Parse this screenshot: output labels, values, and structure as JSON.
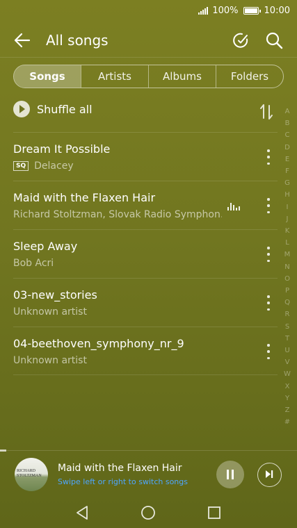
{
  "status": {
    "battery": "100%",
    "time": "10:00"
  },
  "header": {
    "title": "All songs"
  },
  "tabs": [
    {
      "label": "Songs",
      "active": true
    },
    {
      "label": "Artists",
      "active": false
    },
    {
      "label": "Albums",
      "active": false
    },
    {
      "label": "Folders",
      "active": false
    }
  ],
  "shuffle": {
    "label": "Shuffle all"
  },
  "songs": [
    {
      "title": "Dream It Possible",
      "badge": "SQ",
      "artist": "Delacey",
      "playing": false
    },
    {
      "title": "Maid with the Flaxen Hair",
      "artist": "Richard Stoltzman, Slovak Radio Symphon…",
      "playing": true
    },
    {
      "title": "Sleep Away",
      "artist": "Bob Acri",
      "playing": false
    },
    {
      "title": "03-new_stories",
      "artist": "Unknown artist",
      "playing": false
    },
    {
      "title": "04-beethoven_symphony_nr_9",
      "artist": "Unknown artist",
      "playing": false
    }
  ],
  "index_letters": [
    "A",
    "B",
    "C",
    "D",
    "E",
    "F",
    "G",
    "H",
    "I",
    "J",
    "K",
    "L",
    "M",
    "N",
    "O",
    "P",
    "Q",
    "R",
    "S",
    "T",
    "U",
    "V",
    "W",
    "X",
    "Y",
    "Z",
    "#"
  ],
  "now_playing": {
    "title": "Maid with the Flaxen Hair",
    "hint": "Swipe left or right to switch songs",
    "album_art_text": "RICHARD STOLTZMAN",
    "progress": 0.02
  },
  "colors": {
    "background": "#767a21",
    "hint": "#4ea6ff"
  },
  "icons": {
    "back": "back-arrow-icon",
    "edit": "edit-icon",
    "search": "search-icon",
    "shuffle": "play-icon",
    "sort": "sort-icon",
    "more": "more-vert-icon",
    "playing": "equalizer-icon",
    "pause": "pause-icon",
    "next": "skip-next-icon"
  }
}
